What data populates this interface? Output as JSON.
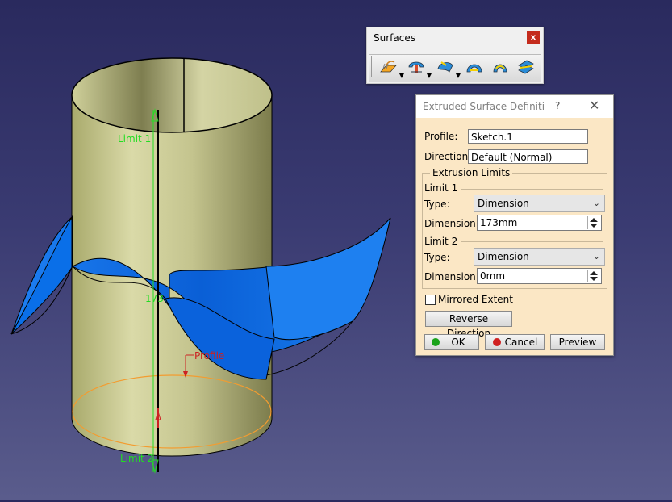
{
  "viewport": {
    "annotations": {
      "limit1": "Limit 1",
      "limit2": "Limit 2",
      "dimension": "173",
      "profile": "Profile"
    },
    "colors": {
      "background_top": "#2a2a5e",
      "background_bottom": "#5a5c8c",
      "cylinder": "#c9c995",
      "surface": "#0a6fe8",
      "annotation_green": "#22dd22",
      "profile_red": "#cc2222",
      "base_orange": "#f39c30"
    }
  },
  "toolbar": {
    "title": "Surfaces",
    "close_label": "x",
    "buttons": [
      {
        "icon": "extrude-surface-icon"
      },
      {
        "icon": "revolve-surface-icon"
      },
      {
        "icon": "sphere-surface-icon"
      },
      {
        "icon": "cylinder-surface-icon"
      },
      {
        "icon": "offset-surface-icon"
      },
      {
        "icon": "sweep-surface-icon"
      }
    ]
  },
  "dialog": {
    "title": "Extruded Surface Definiti...",
    "help_label": "?",
    "close_label": "✕",
    "profile_label": "Profile:",
    "profile_value": "Sketch.1",
    "direction_label": "Direction:",
    "direction_value": "Default (Normal)",
    "group_title": "Extrusion Limits",
    "limit1": {
      "title": "Limit 1",
      "type_label": "Type:",
      "type_value": "Dimension",
      "dimension_label": "Dimension:",
      "dimension_value": "173mm"
    },
    "limit2": {
      "title": "Limit 2",
      "type_label": "Type:",
      "type_value": "Dimension",
      "dimension_label": "Dimension:",
      "dimension_value": "0mm"
    },
    "mirrored_label": "Mirrored Extent",
    "mirrored_checked": false,
    "reverse_label": "Reverse Direction",
    "ok_label": "OK",
    "cancel_label": "Cancel",
    "preview_label": "Preview",
    "colors": {
      "background": "#fbe7c5",
      "ok_dot": "#1aa31a",
      "cancel_dot": "#d02020"
    }
  }
}
